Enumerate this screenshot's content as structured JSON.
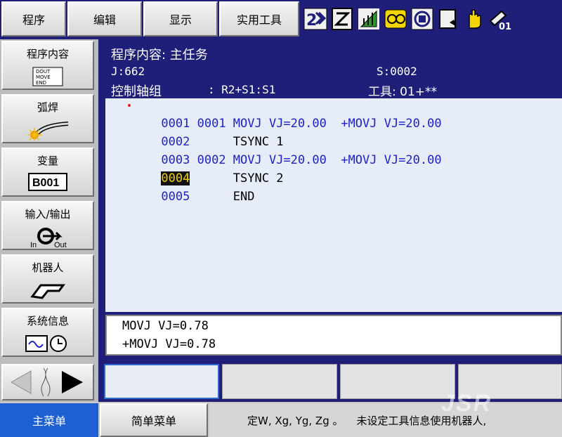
{
  "topmenu": {
    "items": [
      "程序",
      "编辑",
      "显示",
      "实用工具"
    ]
  },
  "status_icons": [
    "speed-2-icon",
    "edit-mode-icon",
    "coordinate-icon",
    "running-icon",
    "servo-icon",
    "step-icon",
    "hand-icon",
    "tool-01-icon"
  ],
  "status_icon_text": {
    "tool_number": "01"
  },
  "leftmenu": {
    "items": [
      {
        "label": "程序内容",
        "icon": "job-content-icon",
        "icon_text": [
          "DOUT",
          "MOVE",
          "END"
        ]
      },
      {
        "label": "弧焊",
        "icon": "arc-weld-icon"
      },
      {
        "label": "变量",
        "icon": "variable-icon",
        "icon_text": "B001"
      },
      {
        "label": "输入/输出",
        "icon": "io-icon",
        "icon_text_in": "In",
        "icon_text_out": "Out"
      },
      {
        "label": "机器人",
        "icon": "robot-icon"
      },
      {
        "label": "系统信息",
        "icon": "system-info-icon"
      }
    ]
  },
  "content": {
    "title": "程序内容: 主任务",
    "job_line": "J:662",
    "step_line": "S:0002",
    "control_group": "控制轴组",
    "control_group_value": ": R2+S1:S1",
    "tool_label": "工具: 01+**",
    "lines": [
      {
        "no": "0001",
        "text": " 0001 MOVJ VJ=20.00  +MOVJ VJ=20.00"
      },
      {
        "no": "0002",
        "text": "      TSYNC 1"
      },
      {
        "no": "0003",
        "text": " 0002 MOVJ VJ=20.00  +MOVJ VJ=20.00"
      },
      {
        "no": "0004",
        "text": "      TSYNC 2"
      },
      {
        "no": "0005",
        "text": "      END"
      }
    ],
    "cursor_line": "0004"
  },
  "edit_buffer": {
    "line1": "MOVJ VJ=0.78",
    "line2": "+MOVJ VJ=0.78"
  },
  "bottom": {
    "main_menu": "主菜单",
    "simple_menu": "简单菜单",
    "message": "定W, Xg, Yg, Zg 。    未设定工具信息使用机器人,"
  },
  "watermark": "JSR",
  "colors": {
    "frame": "#1f1f7a",
    "job_bg": "#e6ecf8",
    "job_text": "#1e22c8",
    "cursor_text": "#f2d000",
    "main_menu_bg": "#1e5fd2"
  }
}
